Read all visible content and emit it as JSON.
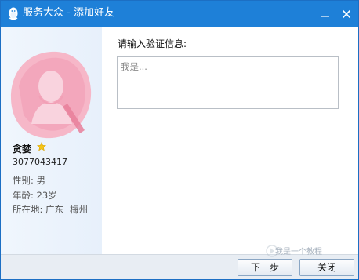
{
  "window": {
    "title": "服务大众 - 添加好友",
    "minimize_icon": "minimize-icon",
    "close_icon": "close-icon",
    "accent_color": "#1e80d8"
  },
  "profile": {
    "nickname": "贪婪",
    "badge_icon": "star-icon",
    "qq_number": "3077043417",
    "gender": "性别: 男",
    "age": "年龄: 23岁",
    "location_label": "所在地: 广东",
    "location_city": "梅州"
  },
  "form": {
    "prompt_label": "请输入验证信息:",
    "message_placeholder": "我是...",
    "message_value": ""
  },
  "footer": {
    "next_label": "下一步",
    "close_label": "关闭"
  },
  "watermark": {
    "icon": "play-circle-icon",
    "text": "我是一个教程"
  }
}
